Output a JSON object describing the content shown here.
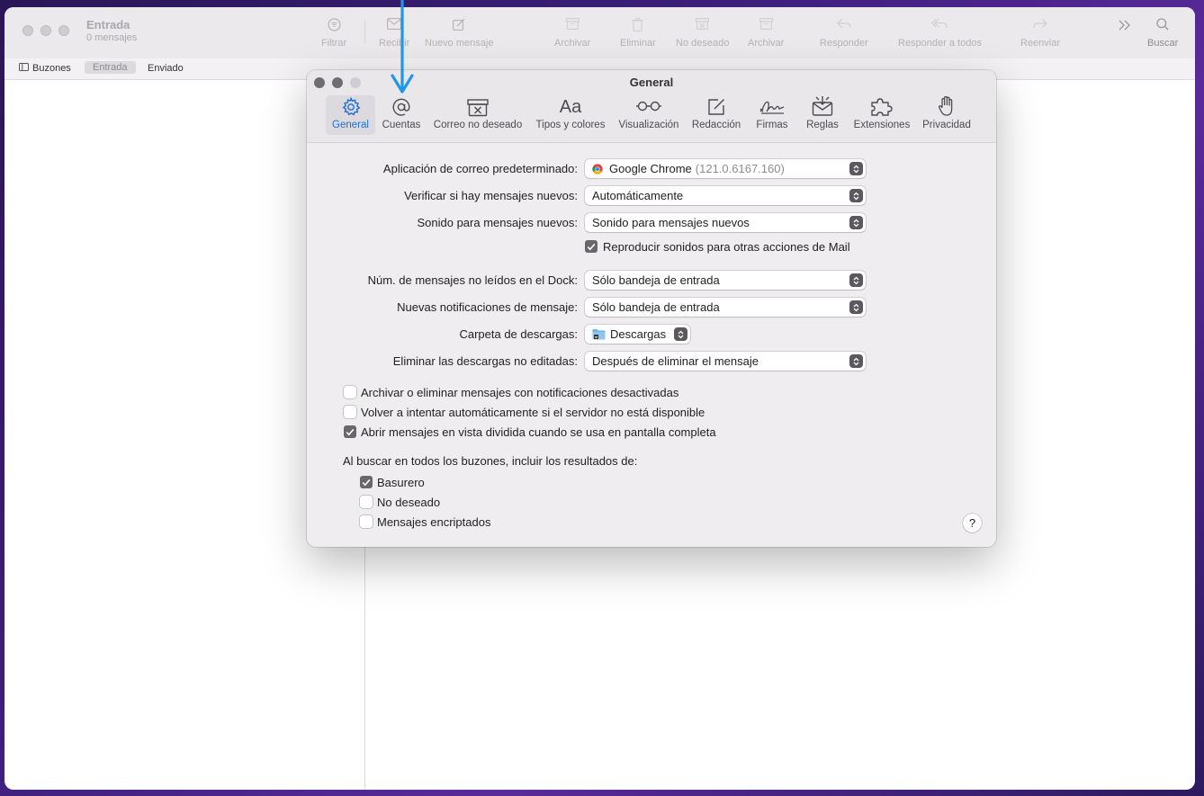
{
  "mail": {
    "title": "Entrada",
    "subtitle": "0 mensajes",
    "toolbar": {
      "filtrar": "Filtrar",
      "recibir": "Recibir",
      "nuevo": "Nuevo mensaje",
      "archivar1": "Archivar",
      "eliminar": "Eliminar",
      "no_deseado": "No deseado",
      "archivar2": "Archivar",
      "responder": "Responder",
      "responder_todos": "Responder a todos",
      "reenviar": "Reenviar",
      "buscar": "Buscar"
    },
    "subbar": {
      "buzones": "Buzones",
      "entrada": "Entrada",
      "enviado": "Enviado"
    }
  },
  "prefs": {
    "title": "General",
    "tabs": {
      "general": "General",
      "cuentas": "Cuentas",
      "correo_no_deseado": "Correo no deseado",
      "tipos": "Tipos y colores",
      "visualizacion": "Visualización",
      "redaccion": "Redacción",
      "firmas": "Firmas",
      "reglas": "Reglas",
      "extensiones": "Extensiones",
      "privacidad": "Privacidad"
    },
    "rows": {
      "app_label": "Aplicación de correo predeterminado:",
      "app_value": "Google Chrome",
      "app_version": "(121.0.6167.160)",
      "verificar_label": "Verificar si hay mensajes nuevos:",
      "verificar_value": "Automáticamente",
      "sonido_label": "Sonido para mensajes nuevos:",
      "sonido_value": "Sonido para mensajes nuevos",
      "reproducir_label": "Reproducir sonidos para otras acciones de Mail",
      "dock_label": "Núm. de mensajes no leídos en el Dock:",
      "dock_value": "Sólo bandeja de entrada",
      "notif_label": "Nuevas notificaciones de mensaje:",
      "notif_value": "Sólo bandeja de entrada",
      "carpeta_label": "Carpeta de descargas:",
      "carpeta_value": "Descargas",
      "eliminar_label": "Eliminar las descargas no editadas:",
      "eliminar_value": "Después de eliminar el mensaje"
    },
    "checks": {
      "archivar": "Archivar o eliminar mensajes con notificaciones desactivadas",
      "volver": "Volver a intentar automáticamente si el servidor no está disponible",
      "abrir": "Abrir mensajes en vista dividida cuando se usa en pantalla completa"
    },
    "search": {
      "heading": "Al buscar en todos los buzones, incluir los resultados de:",
      "basurero": "Basurero",
      "no_deseado": "No deseado",
      "encriptados": "Mensajes encriptados"
    },
    "help": "?"
  },
  "colors": {
    "accent": "#1a6fd6",
    "annotation_arrow": "#2196e8"
  }
}
